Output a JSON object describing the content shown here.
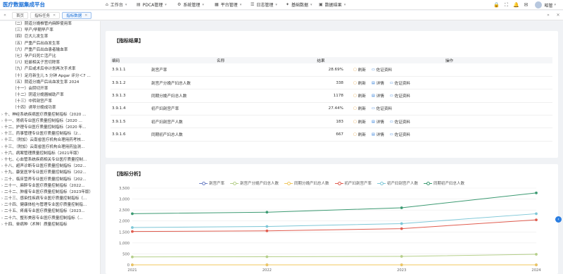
{
  "app": {
    "title": "医疗数据集成平台"
  },
  "menu": [
    {
      "label": "工作台",
      "icon": "⌂"
    },
    {
      "label": "PDCA管理",
      "icon": "▤"
    },
    {
      "label": "系统管理",
      "icon": "⚙"
    },
    {
      "label": "平台管理",
      "icon": "▦"
    },
    {
      "label": "日志管理",
      "icon": "☰"
    },
    {
      "label": "基础数据",
      "icon": "✦"
    },
    {
      "label": "数据结果",
      "icon": "▣"
    }
  ],
  "topbar": {
    "username": "昭管"
  },
  "tabs": [
    {
      "label": "首页",
      "closable": false
    },
    {
      "label": "指标任务",
      "closable": true
    },
    {
      "label": "指标数据",
      "closable": true
    }
  ],
  "sidebar": {
    "items": [
      {
        "label": "（二）阴道分娩椎管内麻醉使用率",
        "indent": 18,
        "caret": false
      },
      {
        "label": "（三）早产/早期早产率",
        "indent": 18,
        "caret": false
      },
      {
        "label": "（四）巨大儿发生率",
        "indent": 18,
        "caret": false
      },
      {
        "label": "（五）严重产后出血发生率",
        "indent": 18,
        "caret": false
      },
      {
        "label": "（六）严重产后出血患者输血率",
        "indent": 18,
        "caret": false
      },
      {
        "label": "（七）孕产妇死亡活产比",
        "indent": 18,
        "caret": false
      },
      {
        "label": "（八）妊娠相关子宫切除率",
        "indent": 18,
        "caret": false
      },
      {
        "label": "（九）产后或术后非计划再次手术率",
        "indent": 18,
        "caret": false
      },
      {
        "label": "（十）足月新生儿 5 分钟 Apgar 评分＜7 ...",
        "indent": 18,
        "caret": false
      },
      {
        "label": "（五）阴道分娩产后出血发生率 2024",
        "indent": 18,
        "caret": false
      },
      {
        "label": "（十一）会阴切开率",
        "indent": 18,
        "caret": false
      },
      {
        "label": "（十二）阴道分娩器械助产率",
        "indent": 18,
        "caret": false
      },
      {
        "label": "（十三）中转剖宫产率",
        "indent": 18,
        "caret": false
      },
      {
        "label": "（十四）诱导分娩成功率",
        "indent": 18,
        "caret": false
      },
      {
        "label": "十、神经系统疾病医疗质量控制指标（2020 ...",
        "indent": 2,
        "caret": true
      },
      {
        "label": "十一、肾病专业医疗质量控制指标（2020 ...",
        "indent": 2,
        "caret": true
      },
      {
        "label": "十二、护理专业医疗质量控制指标（2020 年...",
        "indent": 2,
        "caret": true
      },
      {
        "label": "十三、药事管理专业医疗质量控制指标（2...",
        "indent": 2,
        "caret": true
      },
      {
        "label": "十三、（附加）云南省医疗机构合理用药考核...",
        "indent": 2,
        "caret": true
      },
      {
        "label": "十三、（附加）云南省医疗机构合理用药监测...",
        "indent": 2,
        "caret": true
      },
      {
        "label": "十六、病案管理质量控制指标（2021年版）",
        "indent": 2,
        "caret": true
      },
      {
        "label": "十七、心血管系统疾病相关专业医疗质量控制...",
        "indent": 2,
        "caret": true
      },
      {
        "label": "十八、超声诊断专业医疗质量控制指标（202...",
        "indent": 2,
        "caret": true
      },
      {
        "label": "十九、康复医学专业医疗质量控制指标（202...",
        "indent": 2,
        "caret": true
      },
      {
        "label": "二十、临床营养专业医疗质量控制指标（202...",
        "indent": 2,
        "caret": true
      },
      {
        "label": "二十一、麻醉专业医疗质量控制指标（2022...",
        "indent": 2,
        "caret": true
      },
      {
        "label": "二十二、肿瘤专业医疗质量控制指标（2023年版）",
        "indent": 2,
        "caret": true
      },
      {
        "label": "二十三、感染性疾病专业医疗质量控制指标（...",
        "indent": 2,
        "caret": true
      },
      {
        "label": "二十四、健康体检与管理专业医疗质量控制指...",
        "indent": 2,
        "caret": true
      },
      {
        "label": "二十五、疼痛专业医疗质量控制指标（2023...",
        "indent": 2,
        "caret": true
      },
      {
        "label": "二十六、整形美容专业医疗质量控制指标（...",
        "indent": 2,
        "caret": true
      },
      {
        "label": "十四、单病种（术种）质量控制指标",
        "indent": 2,
        "caret": true
      }
    ]
  },
  "result": {
    "title": "【指标结果】",
    "columns": {
      "code": "编码",
      "name": "名称",
      "result": "结果",
      "op": "操作"
    },
    "ops": {
      "refresh": "刷新",
      "detail": "详情",
      "source": "佐证资料"
    },
    "rows": [
      {
        "code": "3.9.1.1",
        "name": "剖宫产率",
        "result": "28.69%",
        "detail": false
      },
      {
        "code": "3.9.1.2",
        "name": "剖宫产分娩产妇总人数",
        "result": "338",
        "detail": true
      },
      {
        "code": "3.9.1.3",
        "name": "同期分娩产妇总人数",
        "result": "1178",
        "detail": true
      },
      {
        "code": "3.9.1.4",
        "name": "初产妇剖宫产率",
        "result": "27.44%",
        "detail": false
      },
      {
        "code": "3.9.1.5",
        "name": "初产妇剖宫产人数",
        "result": "183",
        "detail": true
      },
      {
        "code": "3.9.1.6",
        "name": "同期初产妇总人数",
        "result": "667",
        "detail": true
      }
    ]
  },
  "analysis": {
    "title": "【指标分析】"
  },
  "colors": {
    "accent": "#1a6fd6",
    "refresh": "#e6a23c"
  },
  "chart_data": {
    "type": "line",
    "x": [
      "2021",
      "2022",
      "2023",
      "2024"
    ],
    "ylim": [
      0,
      3500
    ],
    "yticks": [
      0,
      500,
      1000,
      1500,
      2000,
      2500,
      3000,
      3500
    ],
    "series": [
      {
        "name": "剖宫产率",
        "color": "#6b7fc4",
        "values": [
          0,
          0,
          0,
          0
        ]
      },
      {
        "name": "剖宫产分娩产妇总人数",
        "color": "#b5cf8a",
        "values": [
          360,
          370,
          385,
          480
        ]
      },
      {
        "name": "同期分娩产妇总人数",
        "color": "#f0c75e",
        "values": [
          0,
          0,
          0,
          0
        ]
      },
      {
        "name": "初产妇剖宫产率",
        "color": "#e05c4f",
        "values": [
          1520,
          1550,
          1650,
          2050
        ]
      },
      {
        "name": "初产妇剖宫产人数",
        "color": "#7ec7d7",
        "values": [
          1700,
          1750,
          1880,
          2330
        ]
      },
      {
        "name": "同期初产妇总人数",
        "color": "#3c9a72",
        "values": [
          2330,
          2400,
          2600,
          3280
        ]
      }
    ]
  }
}
